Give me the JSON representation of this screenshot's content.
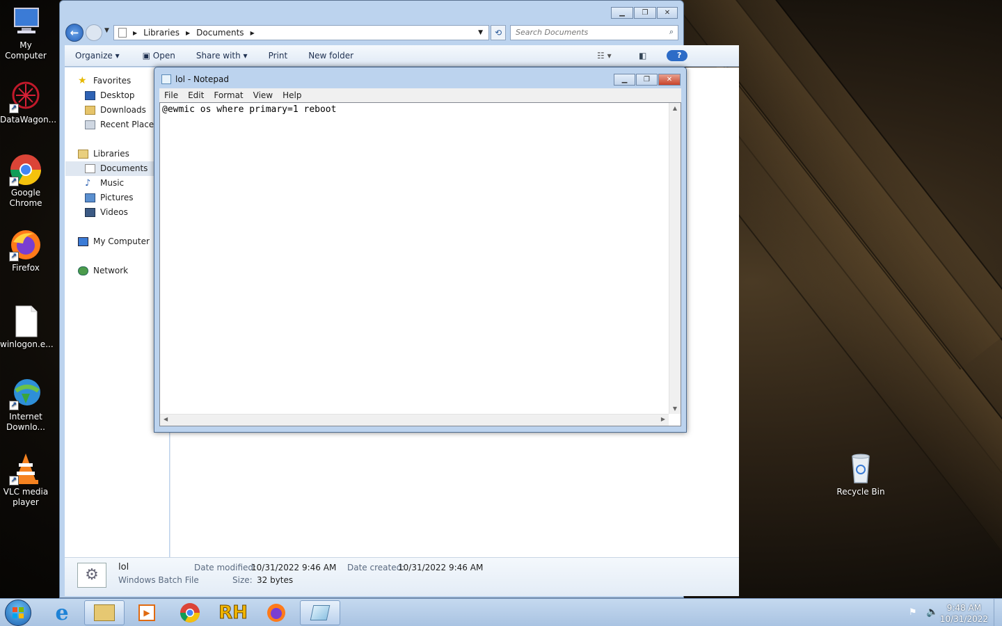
{
  "desktop": {
    "icons": [
      {
        "label": "My\nComputer"
      },
      {
        "label": "DataWagon..."
      },
      {
        "label": "Google\nChrome"
      },
      {
        "label": "Firefox"
      },
      {
        "label": "winlogon.e..."
      },
      {
        "label": "Internet\nDownlo..."
      },
      {
        "label": "VLC media\nplayer"
      },
      {
        "label": "Recycle Bin"
      }
    ]
  },
  "explorer": {
    "breadcrumb": [
      "Libraries",
      "Documents"
    ],
    "search_placeholder": "Search Documents",
    "toolbar": {
      "organize": "Organize",
      "open": "Open",
      "share_with": "Share with",
      "print": "Print",
      "new_folder": "New folder"
    },
    "nav": {
      "favorites": "Favorites",
      "desktop": "Desktop",
      "downloads": "Downloads",
      "recent_places": "Recent Places",
      "libraries": "Libraries",
      "documents": "Documents",
      "music": "Music",
      "pictures": "Pictures",
      "videos": "Videos",
      "my_computer": "My Computer",
      "network": "Network"
    },
    "details": {
      "file_name": "lol",
      "file_type": "Windows Batch File",
      "date_modified_label": "Date modified:",
      "date_modified": "10/31/2022 9:46 AM",
      "size_label": "Size:",
      "size": "32 bytes",
      "date_created_label": "Date created:",
      "date_created": "10/31/2022 9:46 AM"
    }
  },
  "notepad": {
    "title": "lol - Notepad",
    "menu": [
      "File",
      "Edit",
      "Format",
      "View",
      "Help"
    ],
    "content": "@ewmic os where primary=1 reboot"
  },
  "taskbar": {
    "time": "9:48 AM",
    "date": "10/31/2022",
    "pinned": [
      "start-orb-icon",
      "internet-explorer-icon",
      "file-explorer-icon",
      "media-player-icon",
      "chrome-icon",
      "rh-icon",
      "firefox-icon",
      "notepad-icon"
    ]
  }
}
